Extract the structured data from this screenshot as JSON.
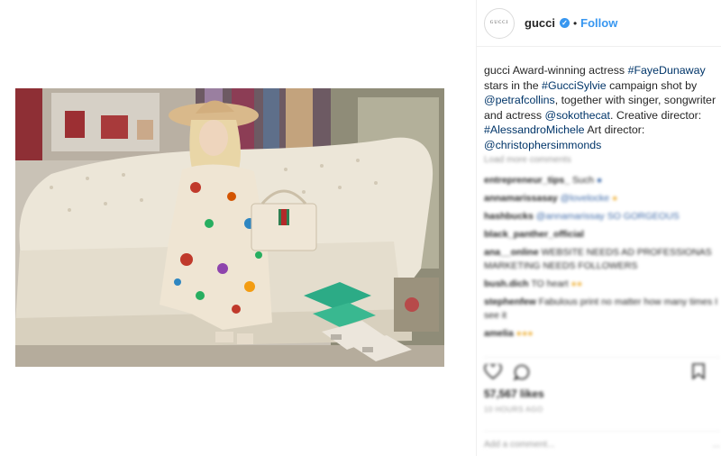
{
  "post": {
    "image_alt_subject": "photo",
    "colors": {
      "accent": "#3897f0",
      "link": "#003569",
      "text": "#262626",
      "muted": "#999999"
    }
  },
  "header": {
    "avatar_text": "GUCCI",
    "username": "gucci",
    "verified_icon": "verified-badge-icon",
    "separator": "•",
    "follow_label": "Follow"
  },
  "caption": {
    "username": "gucci",
    "t1": " Award-winning actress ",
    "tag1": "#FayeDunaway",
    "t2": " stars in the ",
    "tag2": "#GucciSylvie",
    "t3": " campaign shot by ",
    "mention1": "@petrafcollins",
    "t4": ", together with singer, songwriter and actress ",
    "mention2": "@sokothecat",
    "t5": ". Creative director: ",
    "tag3": "#AlessandroMichele",
    "t6": " Art director: ",
    "mention3": "@christophersimmonds"
  },
  "comments": {
    "load_more": "Load more comments",
    "items": [
      {
        "user": "entrepreneur_tips_",
        "text": "Such"
      },
      {
        "user": "annamarissasay",
        "text": "@lovelocke"
      },
      {
        "user": "hashbucks",
        "text": "@annamarissay SO GORGEOUS"
      },
      {
        "user": "black_panther_official",
        "text": ""
      },
      {
        "user": "ana__online",
        "text": "WEBSITE NEEDS AD PROFESSIONAS MARKETING NEEDS FOLLOWERS"
      },
      {
        "user": "bush.dich",
        "text": "TO heart"
      },
      {
        "user": "stephenfew",
        "text": "Fabulous print no matter how many times I see it"
      },
      {
        "user": "amelia",
        "text": ""
      }
    ]
  },
  "actions": {
    "like_icon": "heart-icon",
    "comment_icon": "comment-icon",
    "save_icon": "bookmark-icon"
  },
  "likes": "57,567 likes",
  "timestamp": "10 HOURS AGO",
  "add_comment": {
    "placeholder": "Add a comment...",
    "more": "..."
  }
}
